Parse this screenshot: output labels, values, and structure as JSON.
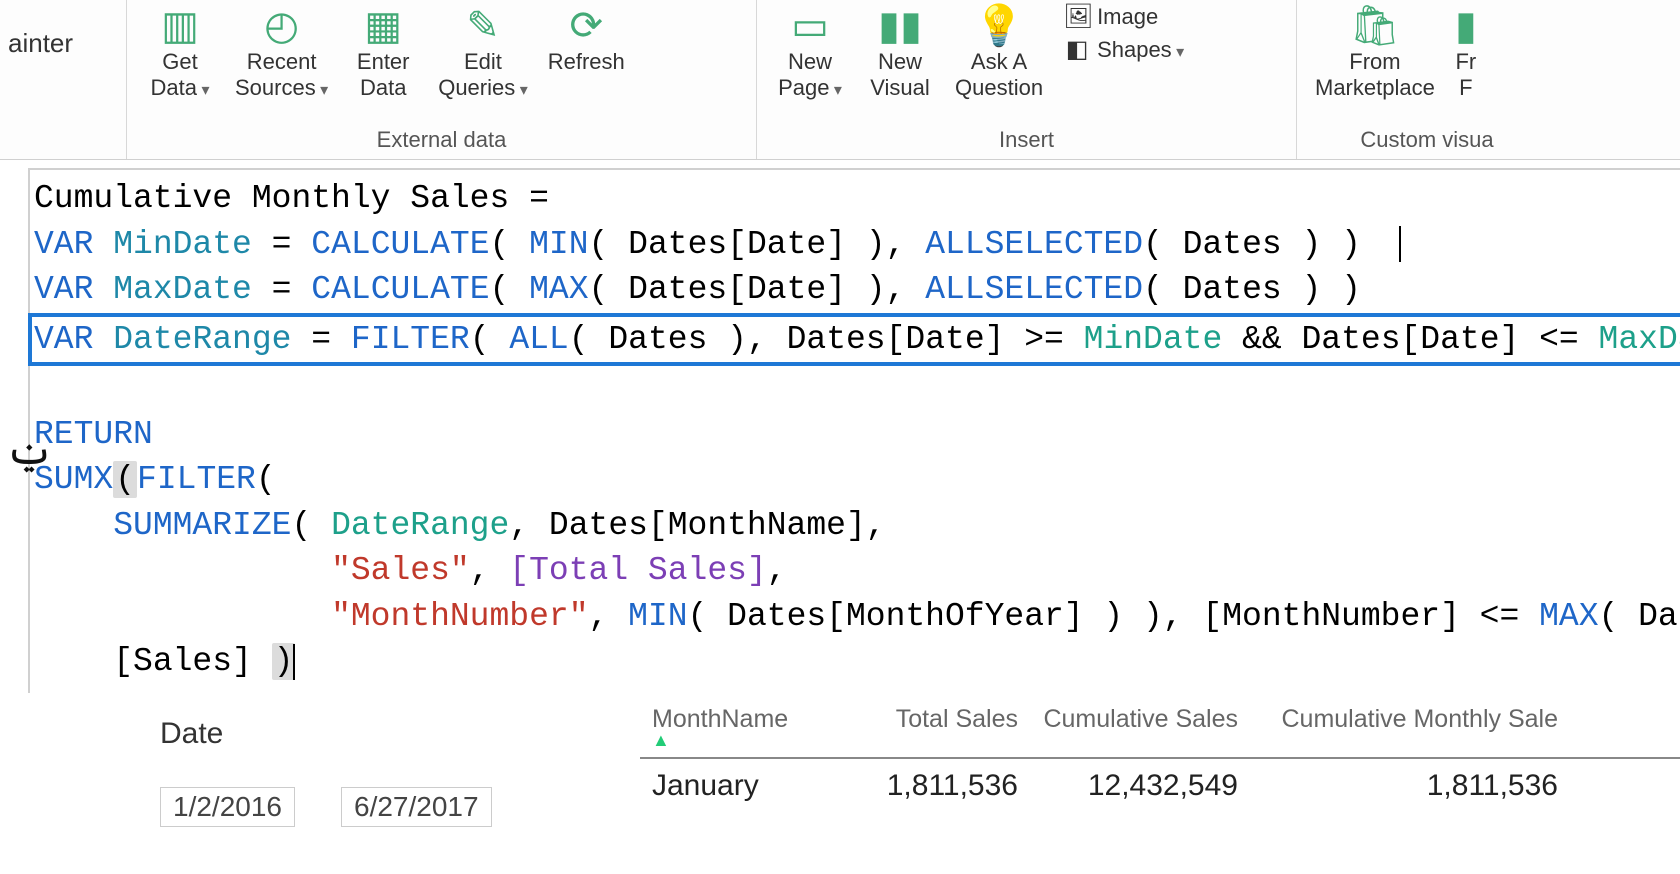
{
  "ribbon": {
    "painter": "ainter",
    "externalData": {
      "label": "External data",
      "getData": "Get\nData",
      "recentSources": "Recent\nSources",
      "enterData": "Enter\nData",
      "editQueries": "Edit\nQueries",
      "refresh": "Refresh"
    },
    "insert": {
      "label": "Insert",
      "newPage": "New\nPage",
      "newVisual": "New\nVisual",
      "askQuestion": "Ask A\nQuestion",
      "image": "Image",
      "shapes": "Shapes"
    },
    "customVisuals": {
      "label": "Custom visua",
      "fromMarketplace": "From\nMarketplace",
      "fromFile": "Fr\nF"
    }
  },
  "formula": {
    "l1_name": "Cumulative Monthly Sales = ",
    "l2": {
      "var": "VAR",
      "name": "MinDate",
      "eq": " = ",
      "calc": "CALCULATE",
      "p1": "( ",
      "min": "MIN",
      "args": "( Dates[Date] ), ",
      "allsel": "ALLSELECTED",
      "tail": "( Dates ) )"
    },
    "l3": {
      "var": "VAR",
      "name": "MaxDate",
      "eq": " = ",
      "calc": "CALCULATE",
      "p1": "( ",
      "max": "MAX",
      "args": "( Dates[Date] ), ",
      "allsel": "ALLSELECTED",
      "tail": "( Dates ) )"
    },
    "l4": {
      "var": "VAR",
      "name": "DateRange",
      "eq": " = ",
      "filter": "FILTER",
      "p1": "( ",
      "all": "ALL",
      "mid": "( Dates ), Dates[Date] >= ",
      "minref": "MinDate",
      "and": " && Dates[Date] <= ",
      "maxref": "MaxDate",
      "tail": " )"
    },
    "l6": "RETURN",
    "l7_sumx": "SUMX",
    "l7_paren": "(",
    "l7_filter": "FILTER",
    "l7_open": "(",
    "l8_pad": "    ",
    "l8_sum": "SUMMARIZE",
    "l8_open": "( ",
    "l8_dr": "DateRange",
    "l8_rest": ", Dates[MonthName],",
    "l9_pad": "               ",
    "l9_s": "\"Sales\"",
    "l9_comma": ", ",
    "l9_meas": "[Total Sales]",
    "l9_tail": ",",
    "l10_pad": "               ",
    "l10_s": "\"MonthNumber\"",
    "l10_comma": ", ",
    "l10_min": "MIN",
    "l10_mid": "( Dates[MonthOfYear] ) ), [MonthNumber] <= ",
    "l10_max": "MAX",
    "l10_tail": "( Dates[M",
    "l11_pad": "    ",
    "l11_sales": "[Sales] ",
    "l11_close": ")"
  },
  "slicer": {
    "title": "Date",
    "start": "1/2/2016",
    "end": "6/27/2017"
  },
  "table": {
    "headers": {
      "month": "MonthName",
      "total": "Total Sales",
      "cum": "Cumulative Sales",
      "cms": "Cumulative Monthly Sale"
    },
    "row1": {
      "month": "January",
      "total": "1,811,536",
      "cum": "12,432,549",
      "cms": "1,811,536"
    }
  }
}
